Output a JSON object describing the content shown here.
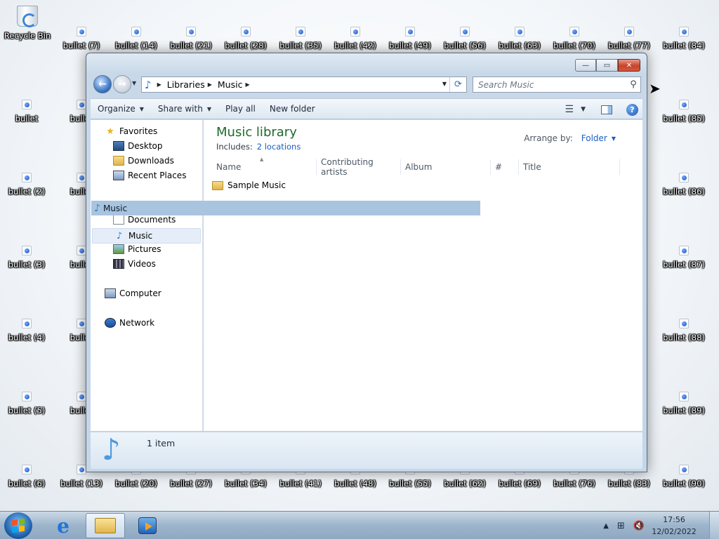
{
  "desktop": {
    "recycle_bin": "Recycle Bin",
    "icons_top": [
      "bullet (7)",
      "bullet (14)",
      "bullet (21)",
      "bullet (28)",
      "bullet (35)",
      "bullet (42)",
      "bullet (49)",
      "bullet (56)",
      "bullet (63)",
      "bullet (70)",
      "bullet (77)",
      "bullet (84)"
    ],
    "icons_left": [
      "bullet",
      "bullet (2)",
      "bullet (3)",
      "bullet (4)",
      "bullet (5)",
      "bullet (6)"
    ],
    "icons_second_col": [
      "bullet",
      "bullet",
      "bullet",
      "bullet",
      "bullet",
      "bullet (13)"
    ],
    "icons_right": [
      "bullet (85)",
      "bullet (86)",
      "bullet (87)",
      "bullet (88)",
      "bullet (89)",
      "bullet (90)"
    ],
    "icons_bottom": [
      "bullet (20)",
      "bullet (27)",
      "bullet (34)",
      "bullet (41)",
      "bullet (48)",
      "bullet (55)",
      "bullet (62)",
      "bullet (69)",
      "bullet (76)",
      "bullet (83)"
    ]
  },
  "window": {
    "caption_buttons": {
      "minimize": "—",
      "maximize": "▭",
      "close": "✕"
    },
    "address": {
      "crumbs": [
        "Libraries",
        "Music"
      ]
    },
    "search": {
      "placeholder": "Search Music"
    },
    "commandbar": {
      "organize": "Organize",
      "share_with": "Share with",
      "play_all": "Play all",
      "new_folder": "New folder"
    },
    "navpane": {
      "favorites": "Favorites",
      "desktop": "Desktop",
      "downloads": "Downloads",
      "recent_places": "Recent Places",
      "music_header": "Music",
      "documents": "Documents",
      "music": "Music",
      "pictures": "Pictures",
      "videos": "Videos",
      "computer": "Computer",
      "network": "Network"
    },
    "library": {
      "title": "Music library",
      "includes_label": "Includes:",
      "includes_link": "2 locations",
      "arrange_label": "Arrange by:",
      "arrange_value": "Folder"
    },
    "columns": [
      "Name",
      "Contributing artists",
      "Album",
      "#",
      "Title"
    ],
    "files": [
      {
        "name": "Sample Music",
        "icon": "folder-icon"
      }
    ],
    "status": {
      "count": "1 item"
    }
  },
  "taskbar": {
    "clock_time": "17:56",
    "clock_date": "12/02/2022",
    "tray_up_arrow": "▲"
  }
}
